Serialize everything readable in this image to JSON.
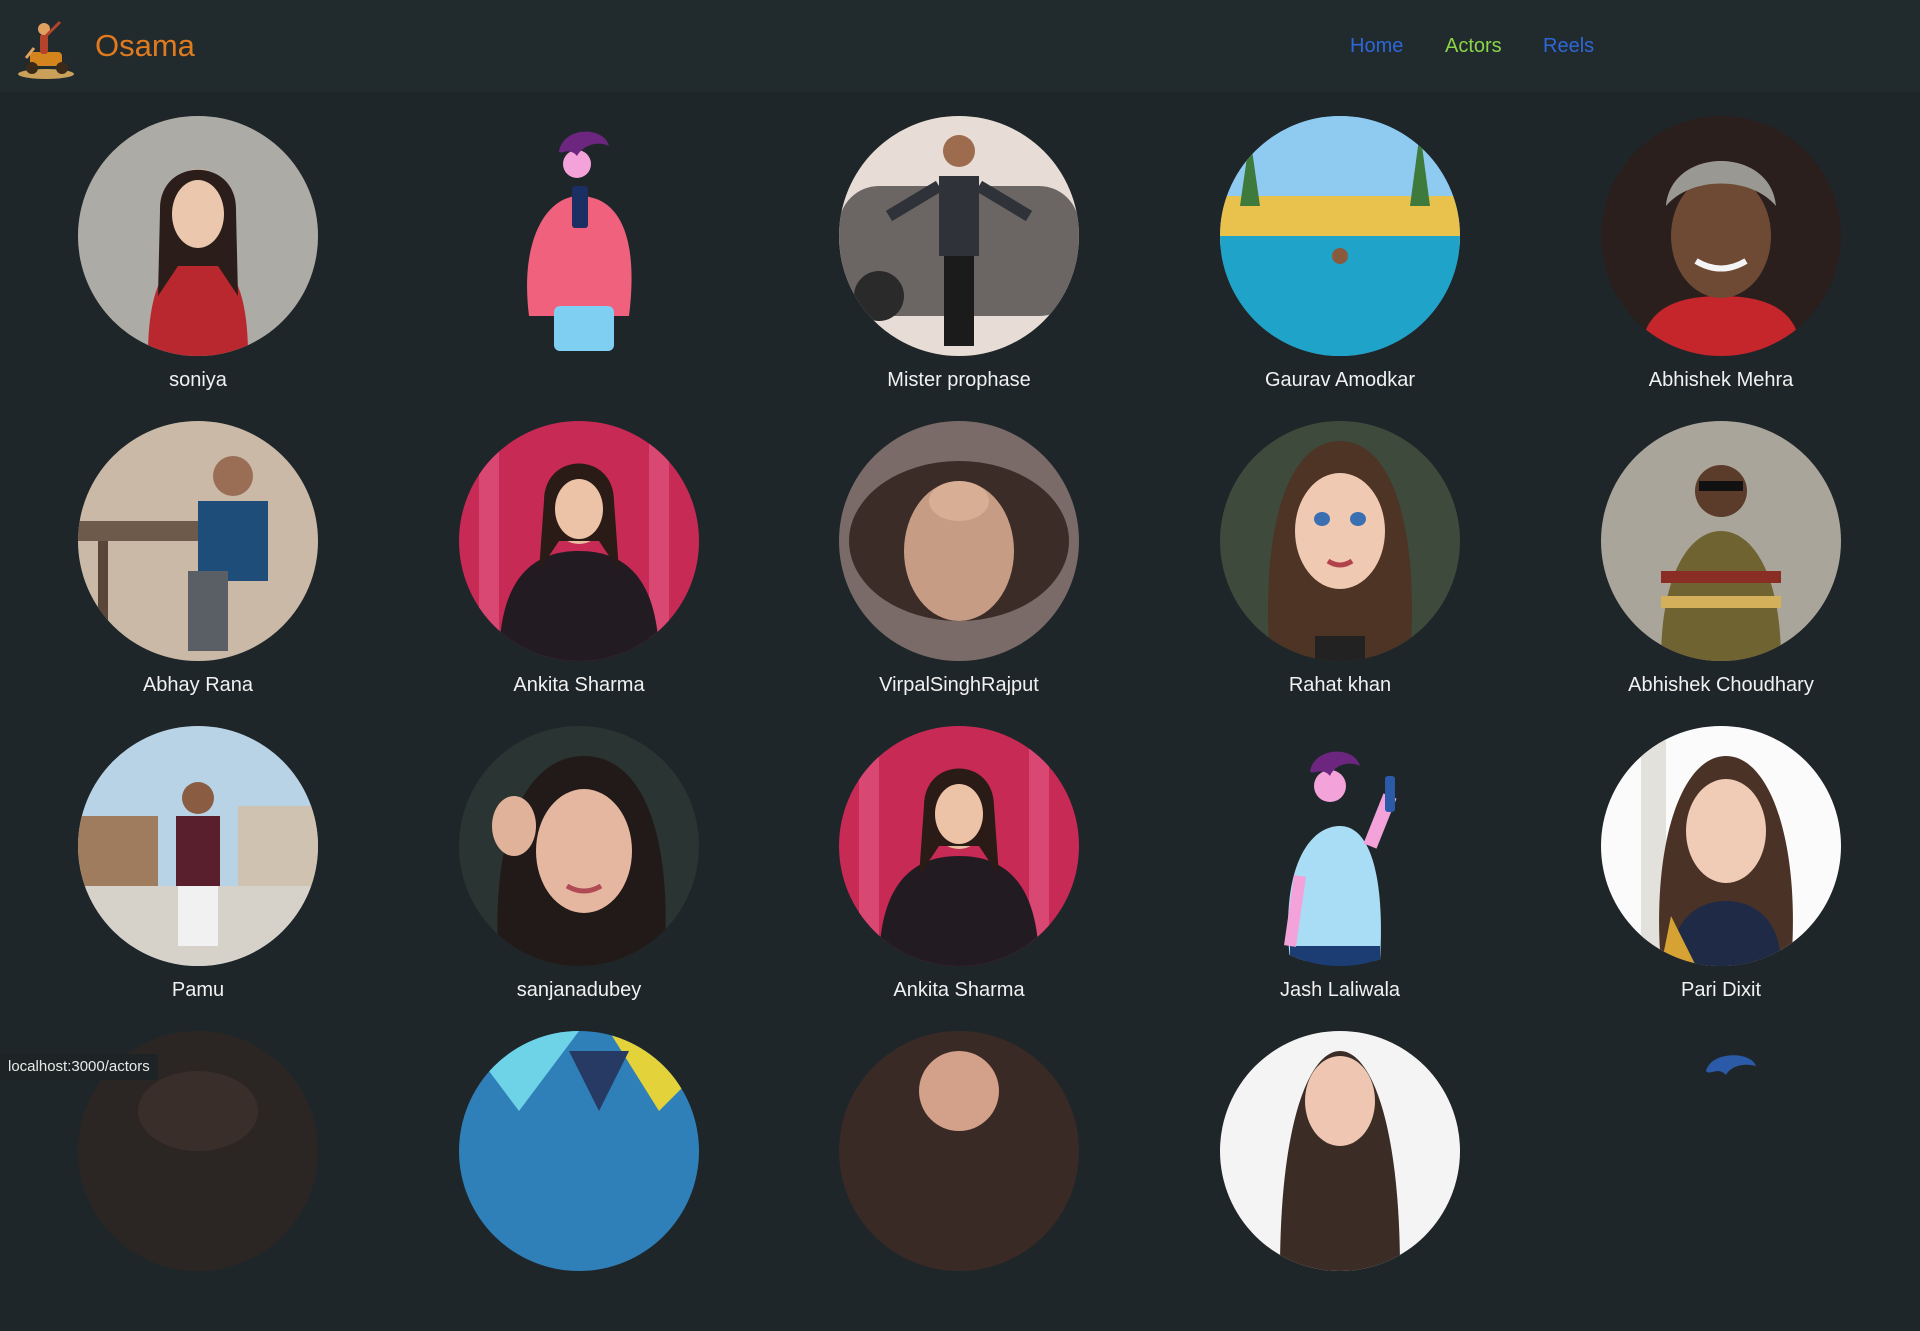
{
  "brand": {
    "name": "Osama",
    "logo_icon": "scooter-rider-logo-icon"
  },
  "nav": {
    "home": "Home",
    "actors": "Actors",
    "reels": "Reels"
  },
  "colors": {
    "accent": "#e07a1f",
    "active_link": "#8bd44a",
    "link": "#2d67d8",
    "background": "#1f2629"
  },
  "actors": [
    {
      "name": "soniya",
      "avatar": "photo"
    },
    {
      "name": "",
      "avatar": "illustration-pink-shirt"
    },
    {
      "name": "Mister prophase",
      "avatar": "photo"
    },
    {
      "name": "Gaurav Amodkar",
      "avatar": "photo"
    },
    {
      "name": "Abhishek Mehra",
      "avatar": "photo"
    },
    {
      "name": "Abhay Rana",
      "avatar": "photo"
    },
    {
      "name": "Ankita Sharma",
      "avatar": "photo"
    },
    {
      "name": "VirpalSinghRajput",
      "avatar": "photo"
    },
    {
      "name": "Rahat khan",
      "avatar": "photo"
    },
    {
      "name": "Abhishek Choudhary",
      "avatar": "photo"
    },
    {
      "name": "Pamu",
      "avatar": "photo"
    },
    {
      "name": "sanjanadubey",
      "avatar": "photo"
    },
    {
      "name": "Ankita Sharma",
      "avatar": "photo"
    },
    {
      "name": "Jash Laliwala",
      "avatar": "illustration-blue-shirt"
    },
    {
      "name": "Pari Dixit",
      "avatar": "photo"
    }
  ],
  "status_url": "localhost:3000/actors"
}
